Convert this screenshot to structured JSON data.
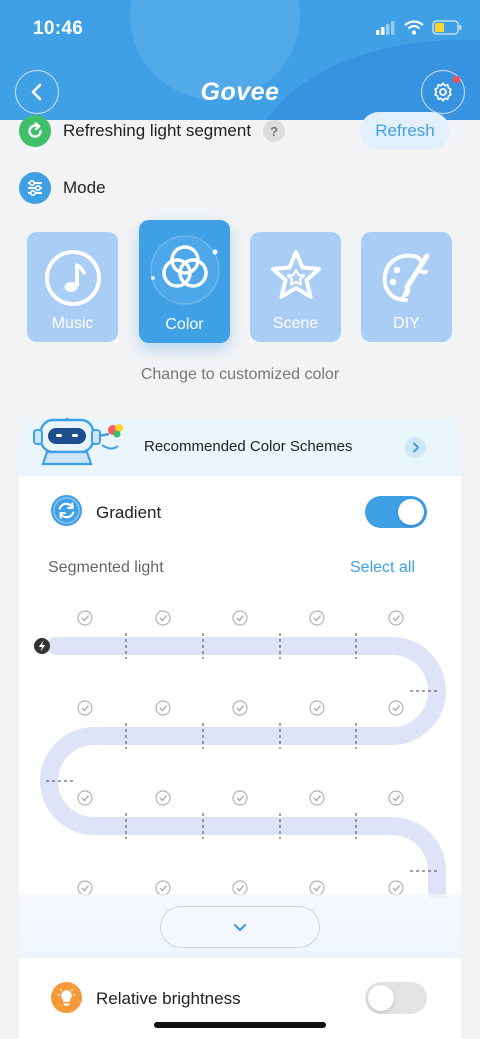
{
  "status_bar": {
    "time": "10:46",
    "icons": [
      "signal-icon",
      "wifi-icon",
      "battery-icon"
    ]
  },
  "header": {
    "brand": "Govee",
    "back_icon": "chevron-left-icon",
    "settings_icon": "gear-icon",
    "accent": "#3fa0e6"
  },
  "segment_refresh": {
    "label": "Refreshing light segment",
    "help": "?",
    "button": "Refresh"
  },
  "mode": {
    "title": "Mode",
    "tiles": [
      {
        "label": "Music",
        "icon": "music-note-icon",
        "active": false
      },
      {
        "label": "Color",
        "icon": "color-circles-icon",
        "active": true
      },
      {
        "label": "Scene",
        "icon": "star-icon",
        "active": false
      },
      {
        "label": "DIY",
        "icon": "palette-brush-icon",
        "active": false
      }
    ],
    "caption": "Change to customized color"
  },
  "panel": {
    "banner": "Recommended Color Schemes",
    "gradient": {
      "label": "Gradient",
      "enabled": true
    },
    "segmented": {
      "label": "Segmented light",
      "select_all": "Select all"
    },
    "relative_brightness": {
      "label": "Relative brightness",
      "enabled": false
    }
  },
  "colors": {
    "accent": "#3fa0e6",
    "strip": "#dfe3f8",
    "green": "#3fbf6a",
    "orange": "#f59a38"
  }
}
